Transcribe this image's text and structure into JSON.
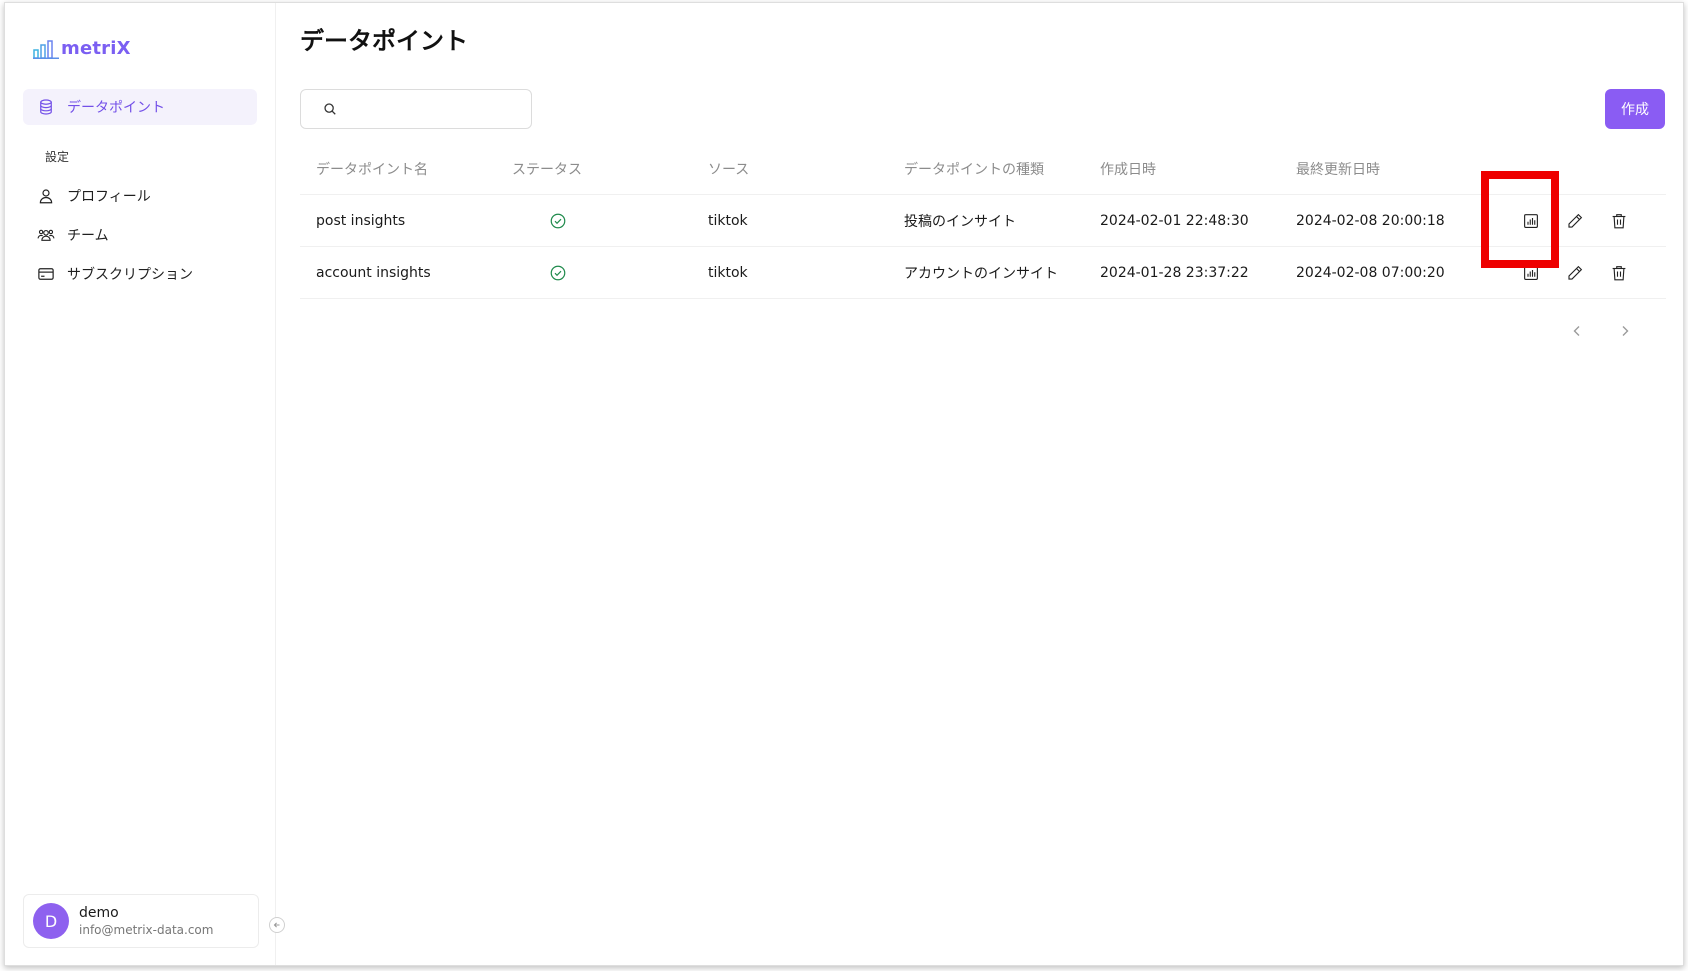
{
  "app": {
    "logo_text": "metriX",
    "brand_color": "#7b5ff2"
  },
  "sidebar": {
    "items": [
      {
        "label": "データポイント",
        "icon": "database-icon",
        "active": true
      },
      {
        "label": "プロフィール",
        "icon": "user-icon",
        "active": false
      },
      {
        "label": "チーム",
        "icon": "team-icon",
        "active": false
      },
      {
        "label": "サブスクリプション",
        "icon": "credit-card-icon",
        "active": false
      }
    ],
    "section_label": "設定"
  },
  "user": {
    "initial": "D",
    "name": "demo",
    "email": "info@metrix-data.com"
  },
  "page": {
    "title": "データポイント"
  },
  "search": {
    "value": "",
    "placeholder": ""
  },
  "toolbar": {
    "create_label": "作成"
  },
  "table": {
    "columns": [
      "データポイント名",
      "ステータス",
      "ソース",
      "データポイントの種類",
      "作成日時",
      "最終更新日時"
    ],
    "rows": [
      {
        "name": "post insights",
        "status": "active",
        "source": "tiktok",
        "type": "投稿のインサイト",
        "created": "2024-02-01 22:48:30",
        "updated": "2024-02-08 20:00:18"
      },
      {
        "name": "account insights",
        "status": "active",
        "source": "tiktok",
        "type": "アカウントのインサイト",
        "created": "2024-01-28 23:37:22",
        "updated": "2024-02-08 07:00:20"
      }
    ]
  },
  "colors": {
    "accent": "#8a5cf3",
    "status_ok": "#1f8a4c",
    "highlight": "#ee0000"
  }
}
